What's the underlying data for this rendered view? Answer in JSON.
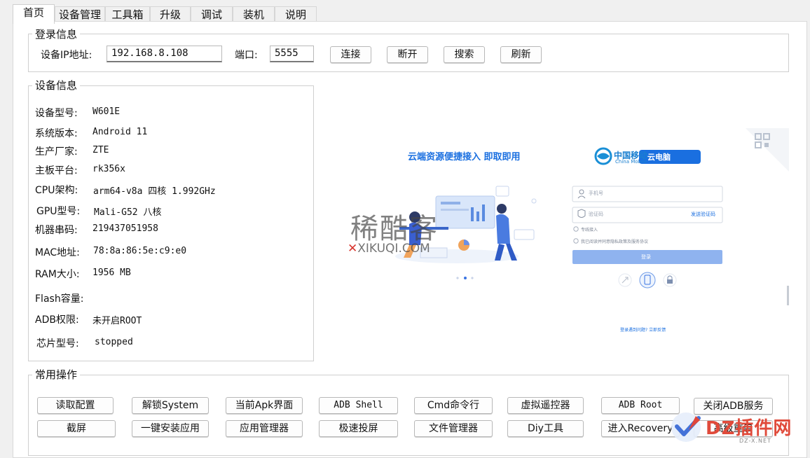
{
  "tabs": [
    "首页",
    "设备管理",
    "工具箱",
    "升级",
    "调试",
    "装机",
    "说明"
  ],
  "login": {
    "title": "登录信息",
    "ip_label": "设备IP地址:",
    "ip_value": "192.168.8.108",
    "port_label": "端口:",
    "port_value": "5555",
    "buttons": [
      "连接",
      "断开",
      "搜索",
      "刷新"
    ]
  },
  "device": {
    "title": "设备信息",
    "rows": [
      {
        "label": "设备型号:",
        "value": "W601E"
      },
      {
        "label": "系统版本:",
        "value": "Android 11"
      },
      {
        "label": "生产厂家:",
        "value": "ZTE"
      },
      {
        "label": "主板平台:",
        "value": "rk356x"
      },
      {
        "label": "CPU架构:",
        "value": "arm64-v8a 四核 1.992GHz"
      },
      {
        "label": "GPU型号:",
        "value": "Mali-G52 八核"
      },
      {
        "label": "机器串码:",
        "value": "219437051958"
      },
      {
        "label": "MAC地址:",
        "value": "78:8a:86:5e:c9:e0"
      },
      {
        "label": "RAM大小:",
        "value": "1956 MB"
      },
      {
        "label": "Flash容量:",
        "value": ""
      },
      {
        "label": "ADB权限:",
        "value": "未开启ROOT"
      },
      {
        "label": "芯片型号:",
        "value": "stopped"
      }
    ]
  },
  "preview": {
    "slogan": "云端资源便捷接入 即取即用",
    "brand_cn": "中国移动",
    "brand_en": "China Mobile",
    "product_badge": "云电脑",
    "phone_placeholder": "手机号",
    "code_placeholder": "验证码",
    "send_code": "发送验证码",
    "line_access": "专线接入",
    "agreement": "我已阅读并同意隐私政策及服务协议",
    "login_button": "登录",
    "help_link": "登录遇到问题? 立即反馈",
    "watermark_cn": "稀酷客",
    "watermark_en": "XIKUQI.COM"
  },
  "ops": {
    "title": "常用操作",
    "row1": [
      "读取配置",
      "解锁System",
      "当前Apk界面",
      "ADB Shell",
      "Cmd命令行",
      "虚拟遥控器",
      "ADB  Root",
      "关闭ADB服务"
    ],
    "row2": [
      "截屏",
      "一键安装应用",
      "应用管理器",
      "极速投屏",
      "文件管理器",
      "Diy工具",
      "进入Recovery",
      "高级重启"
    ]
  },
  "corner_watermark": {
    "text": "DZ插件网",
    "sub": "DZ-X.NET"
  },
  "colors": {
    "accent_blue": "#1a6fe0",
    "login_button": "#8fb3ef",
    "watermark_red": "#d8362f"
  }
}
